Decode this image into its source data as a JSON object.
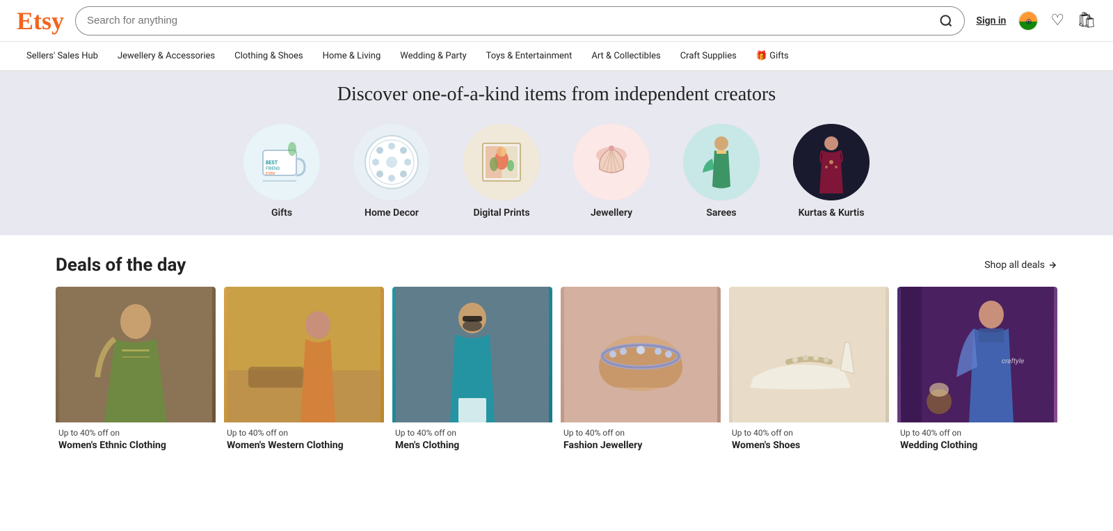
{
  "header": {
    "logo": "Etsy",
    "search_placeholder": "Search for anything",
    "sign_in": "Sign in",
    "nav_items": [
      {
        "label": "Sellers' Sales Hub",
        "id": "sellers-sales-hub"
      },
      {
        "label": "Jewellery & Accessories",
        "id": "jewellery-accessories"
      },
      {
        "label": "Clothing & Shoes",
        "id": "clothing-shoes"
      },
      {
        "label": "Home & Living",
        "id": "home-living"
      },
      {
        "label": "Wedding & Party",
        "id": "wedding-party"
      },
      {
        "label": "Toys & Entertainment",
        "id": "toys-entertainment"
      },
      {
        "label": "Art & Collectibles",
        "id": "art-collectibles"
      },
      {
        "label": "Craft Supplies",
        "id": "craft-supplies"
      },
      {
        "label": "🎁 Gifts",
        "id": "gifts-nav"
      }
    ]
  },
  "banner": {
    "title": "Discover one-of-a-kind items from independent creators"
  },
  "categories": [
    {
      "label": "Gifts",
      "id": "gifts",
      "emoji": "☕"
    },
    {
      "label": "Home Decor",
      "id": "home-decor",
      "emoji": "🍽️"
    },
    {
      "label": "Digital Prints",
      "id": "digital-prints",
      "emoji": "🖼️"
    },
    {
      "label": "Jewellery",
      "id": "jewellery",
      "emoji": "💎"
    },
    {
      "label": "Sarees",
      "id": "sarees",
      "emoji": "👘"
    },
    {
      "label": "Kurtas & Kurtis",
      "id": "kurtas",
      "emoji": "👗"
    }
  ],
  "deals": {
    "title": "Deals of the day",
    "shop_all_label": "Shop all deals →",
    "items": [
      {
        "discount": "Up to 40% off on",
        "name": "Women's Ethnic Clothing",
        "id": "womens-ethnic"
      },
      {
        "discount": "Up to 40% off on",
        "name": "Women's Western Clothing",
        "id": "womens-western"
      },
      {
        "discount": "Up to 40% off on",
        "name": "Men's Clothing",
        "id": "mens-clothing"
      },
      {
        "discount": "Up to 40% off on",
        "name": "Fashion Jewellery",
        "id": "fashion-jewellery"
      },
      {
        "discount": "Up to 40% off on",
        "name": "Women's Shoes",
        "id": "womens-shoes"
      },
      {
        "discount": "Up to 40% off on",
        "name": "Wedding Clothing",
        "id": "wedding-clothing"
      }
    ]
  }
}
